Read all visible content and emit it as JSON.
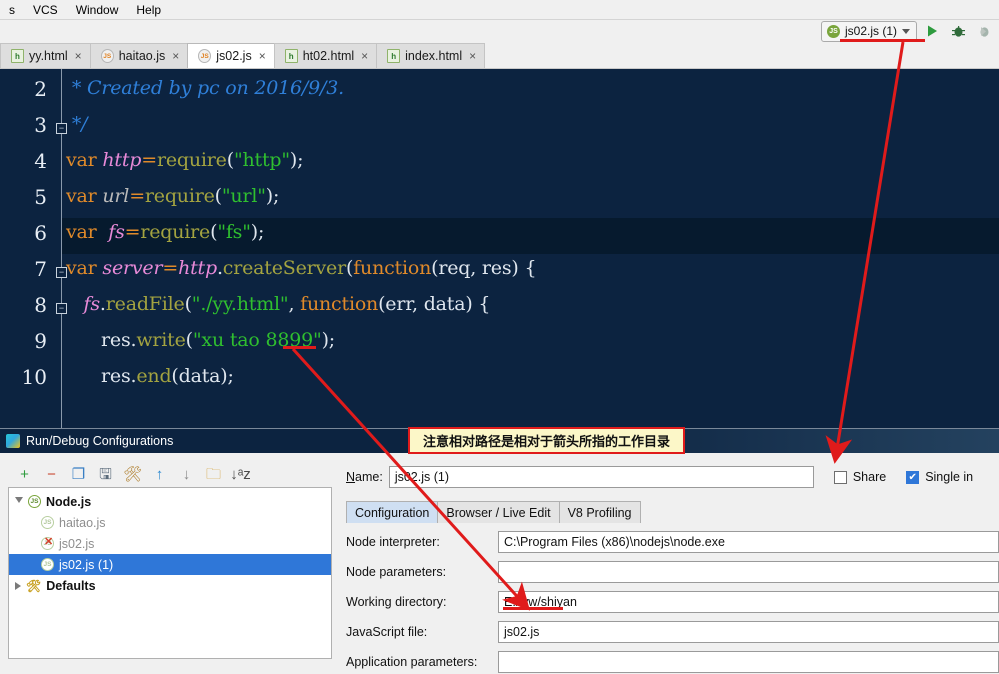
{
  "menubar": {
    "items": [
      "s",
      "VCS",
      "Window",
      "Help"
    ]
  },
  "run_widget": {
    "config_name": "js02.js (1)",
    "config_icon": "js-node-icon",
    "run_label": "▶",
    "debug_label": "🐞",
    "coverage_label": "▶"
  },
  "editor_tabs": [
    {
      "label": "yy.html",
      "type": "html",
      "badge": "h",
      "active": false,
      "close": "×"
    },
    {
      "label": "haitao.js",
      "type": "js",
      "badge": "JS",
      "active": false,
      "close": "×"
    },
    {
      "label": "js02.js",
      "type": "js",
      "badge": "JS",
      "active": true,
      "close": "×"
    },
    {
      "label": "ht02.html",
      "type": "html",
      "badge": "h",
      "active": false,
      "close": "×"
    },
    {
      "label": "index.html",
      "type": "html",
      "badge": "h",
      "active": false,
      "close": "×"
    }
  ],
  "editor": {
    "background": "#0c2340",
    "highlight_line": 6,
    "lines": [
      {
        "num": "2",
        "tokens": [
          {
            "t": " * Created by pc on 2016/9/3.",
            "c": "c-comment"
          }
        ]
      },
      {
        "num": "3",
        "tokens": [
          {
            "t": " */",
            "c": "c-comment"
          }
        ],
        "fold": "open"
      },
      {
        "num": "4",
        "tokens": [
          {
            "t": "var ",
            "c": "c-kw"
          },
          {
            "t": "http",
            "c": "c-var"
          },
          {
            "t": "=",
            "c": "c-kw"
          },
          {
            "t": "require",
            "c": "c-fn"
          },
          {
            "t": "(",
            "c": "c-plain"
          },
          {
            "t": "\"http\"",
            "c": "c-str"
          },
          {
            "t": ");",
            "c": "c-plain"
          }
        ]
      },
      {
        "num": "5",
        "tokens": [
          {
            "t": "var ",
            "c": "c-kw"
          },
          {
            "t": "url",
            "c": "c-var-g"
          },
          {
            "t": "=",
            "c": "c-kw"
          },
          {
            "t": "require",
            "c": "c-fn"
          },
          {
            "t": "(",
            "c": "c-plain"
          },
          {
            "t": "\"url\"",
            "c": "c-str"
          },
          {
            "t": ");",
            "c": "c-plain"
          }
        ]
      },
      {
        "num": "6",
        "tokens": [
          {
            "t": "var  ",
            "c": "c-kw"
          },
          {
            "t": "fs",
            "c": "c-var"
          },
          {
            "t": "=",
            "c": "c-kw"
          },
          {
            "t": "require",
            "c": "c-fn"
          },
          {
            "t": "(",
            "c": "c-plain"
          },
          {
            "t": "\"fs\"",
            "c": "c-str"
          },
          {
            "t": ");",
            "c": "c-plain"
          }
        ]
      },
      {
        "num": "7",
        "tokens": [
          {
            "t": "var ",
            "c": "c-kw"
          },
          {
            "t": "server",
            "c": "c-var"
          },
          {
            "t": "=",
            "c": "c-kw"
          },
          {
            "t": "http",
            "c": "c-var"
          },
          {
            "t": ".",
            "c": "c-plain"
          },
          {
            "t": "createServer",
            "c": "c-fn"
          },
          {
            "t": "(",
            "c": "c-plain"
          },
          {
            "t": "function",
            "c": "c-kw"
          },
          {
            "t": "(req, res) {",
            "c": "c-plain"
          }
        ],
        "fold": "collapse"
      },
      {
        "num": "8",
        "tokens": [
          {
            "t": "   ",
            "c": "c-plain"
          },
          {
            "t": "fs",
            "c": "c-var"
          },
          {
            "t": ".",
            "c": "c-plain"
          },
          {
            "t": "readFile",
            "c": "c-fn"
          },
          {
            "t": "(",
            "c": "c-plain"
          },
          {
            "t": "\"./yy.html\"",
            "c": "c-str"
          },
          {
            "t": ", ",
            "c": "c-plain"
          },
          {
            "t": "function",
            "c": "c-kw"
          },
          {
            "t": "(err, data) {",
            "c": "c-plain"
          }
        ],
        "fold": "collapse"
      },
      {
        "num": "9",
        "tokens": [
          {
            "t": "      res.",
            "c": "c-plain"
          },
          {
            "t": "write",
            "c": "c-fn"
          },
          {
            "t": "(",
            "c": "c-plain"
          },
          {
            "t": "\"xu tao 8899\"",
            "c": "c-str"
          },
          {
            "t": ");",
            "c": "c-plain"
          }
        ]
      },
      {
        "num": "10",
        "tokens": [
          {
            "t": "      res.",
            "c": "c-plain"
          },
          {
            "t": "end",
            "c": "c-fn"
          },
          {
            "t": "(data);",
            "c": "c-plain"
          }
        ]
      }
    ]
  },
  "dialog": {
    "title": "Run/Debug Configurations",
    "toolbar": [
      {
        "name": "add-button",
        "glyph": "+",
        "color": "#2e9b3e"
      },
      {
        "name": "remove-button",
        "glyph": "−",
        "color": "#c8452e"
      },
      {
        "name": "copy-button",
        "glyph": "❐",
        "color": "#3a7fc4"
      },
      {
        "name": "save-button",
        "glyph": "🖫",
        "color": "#5a6a7a"
      },
      {
        "name": "edit-templates-button",
        "glyph": "🛠",
        "color": "#b08030"
      },
      {
        "name": "move-up-button",
        "glyph": "↑",
        "color": "#2f8ad0"
      },
      {
        "name": "move-down-button",
        "glyph": "↓",
        "color": "#8a8a8a"
      },
      {
        "name": "folder-button",
        "glyph": "🗀",
        "color": "#d09a2c"
      },
      {
        "name": "sort-button",
        "glyph": "↓ᵃz",
        "color": "#4a4a4a"
      }
    ],
    "tree": [
      {
        "label": "Node.js",
        "level": 0,
        "bold": true,
        "icon": "node-icon",
        "expander": "open",
        "selected": false,
        "error": false
      },
      {
        "label": "haitao.js",
        "level": 1,
        "bold": false,
        "icon": "node-icon-faded",
        "expander": "none",
        "selected": false,
        "error": false
      },
      {
        "label": "js02.js",
        "level": 1,
        "bold": false,
        "icon": "node-icon-faded",
        "expander": "none",
        "selected": false,
        "error": true
      },
      {
        "label": "js02.js (1)",
        "level": 1,
        "bold": false,
        "icon": "node-icon-faded",
        "expander": "none",
        "selected": true,
        "error": false
      },
      {
        "label": "Defaults",
        "level": 0,
        "bold": true,
        "icon": "wrench-icon",
        "expander": "closed",
        "selected": false,
        "error": false
      }
    ],
    "name_label": "Name:",
    "name_value": "js02.js (1)",
    "share_label": "Share",
    "share_checked": false,
    "single_instance_label": "Single in",
    "single_instance_checked": true,
    "tabs": [
      {
        "label": "Configuration",
        "active": true
      },
      {
        "label": "Browser / Live Edit",
        "active": false
      },
      {
        "label": "V8 Profiling",
        "active": false
      }
    ],
    "fields": [
      {
        "label": "Node interpreter:",
        "value": "C:\\Program Files (x86)\\nodejs\\node.exe"
      },
      {
        "label": "Node parameters:",
        "value": ""
      },
      {
        "label": "Working directory:",
        "value": "E:/ww/shiyan"
      },
      {
        "label": "JavaScript file:",
        "value": "js02.js"
      },
      {
        "label": "Application parameters:",
        "value": ""
      }
    ]
  },
  "annotation": {
    "note_text": "注意相对路径是相对于箭头所指的工作目录",
    "note_color": "#e01b1b",
    "note_bg": "#fcf7c8"
  }
}
